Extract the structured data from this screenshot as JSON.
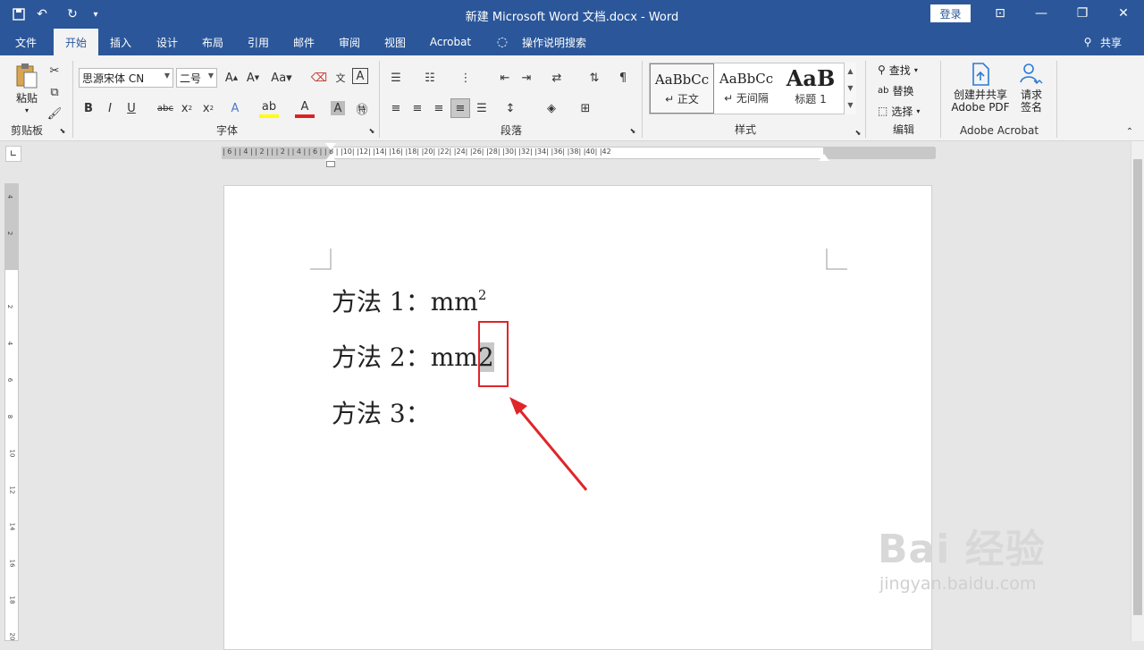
{
  "window": {
    "title": "新建 Microsoft Word 文档.docx  -  Word",
    "login": "登录"
  },
  "tabs": [
    "文件",
    "开始",
    "插入",
    "设计",
    "布局",
    "引用",
    "邮件",
    "审阅",
    "视图",
    "Acrobat"
  ],
  "tell_me": "操作说明搜索",
  "share": "共享",
  "ribbon": {
    "clipboard": {
      "paste": "粘贴",
      "label": "剪贴板"
    },
    "font": {
      "name": "思源宋体 CN",
      "size": "二号",
      "label": "字体"
    },
    "paragraph": {
      "label": "段落"
    },
    "styles": {
      "label": "样式",
      "items": [
        {
          "sample": "AaBbCc",
          "name": "↵ 正文"
        },
        {
          "sample": "AaBbCc",
          "name": "↵ 无间隔"
        },
        {
          "sample": "AaB",
          "name": "标题 1"
        }
      ]
    },
    "editing": {
      "find": "查找",
      "replace": "替换",
      "select": "选择",
      "label": "编辑"
    },
    "acrobat": {
      "create_line1": "创建并共享",
      "create_line2": "Adobe PDF",
      "sign_line1": "请求",
      "sign_line2": "签名",
      "label": "Adobe Acrobat"
    }
  },
  "ruler": {
    "marks": "| 6 |  | 4 |  | 2 |     |     | 2 |  | 4 |  | 6 |  | 8 |  |10|  |12|  |14|  |16|  |18|  |20|  |22|  |24|  |26|  |28|  |30|  |32|  |34|  |36|  |38|  |40|  |42"
  },
  "document": {
    "line1_text": "方法 1：mm",
    "line1_sup": "2",
    "line2_text": "方法 2：mm",
    "line2_sel": "2",
    "line3_text": "方法 3："
  },
  "watermark": {
    "main": "Bai  经验",
    "sub": "jingyan.baidu.com"
  },
  "colors": {
    "brand": "#2b579a",
    "annotation_red": "#e0252a"
  }
}
